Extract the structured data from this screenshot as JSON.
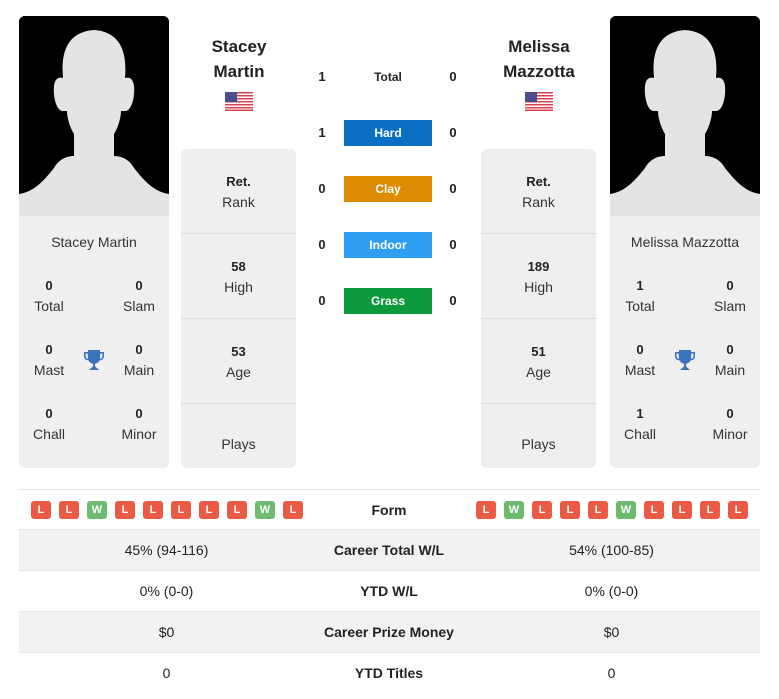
{
  "players": {
    "left": {
      "name_line1": "Stacey",
      "name_line2": "Martin",
      "full_name": "Stacey Martin",
      "country_flag": "us-flag-icon",
      "titles": {
        "total": {
          "value": "0",
          "label": "Total"
        },
        "slam": {
          "value": "0",
          "label": "Slam"
        },
        "mast": {
          "value": "0",
          "label": "Mast"
        },
        "main": {
          "value": "0",
          "label": "Main"
        },
        "chall": {
          "value": "0",
          "label": "Chall"
        },
        "minor": {
          "value": "0",
          "label": "Minor"
        }
      },
      "info": {
        "rank": {
          "value": "Ret.",
          "label": "Rank"
        },
        "high": {
          "value": "58",
          "label": "High"
        },
        "age": {
          "value": "53",
          "label": "Age"
        },
        "plays": {
          "value": "",
          "label": "Plays"
        }
      },
      "form": [
        "L",
        "L",
        "W",
        "L",
        "L",
        "L",
        "L",
        "L",
        "W",
        "L"
      ]
    },
    "right": {
      "name_line1": "Melissa",
      "name_line2": "Mazzotta",
      "full_name": "Melissa Mazzotta",
      "country_flag": "us-flag-icon",
      "titles": {
        "total": {
          "value": "1",
          "label": "Total"
        },
        "slam": {
          "value": "0",
          "label": "Slam"
        },
        "mast": {
          "value": "0",
          "label": "Mast"
        },
        "main": {
          "value": "0",
          "label": "Main"
        },
        "chall": {
          "value": "1",
          "label": "Chall"
        },
        "minor": {
          "value": "0",
          "label": "Minor"
        }
      },
      "info": {
        "rank": {
          "value": "Ret.",
          "label": "Rank"
        },
        "high": {
          "value": "189",
          "label": "High"
        },
        "age": {
          "value": "51",
          "label": "Age"
        },
        "plays": {
          "value": "",
          "label": "Plays"
        }
      },
      "form": [
        "L",
        "W",
        "L",
        "L",
        "L",
        "W",
        "L",
        "L",
        "L",
        "L"
      ]
    }
  },
  "h2h": [
    {
      "label": "Total",
      "left": "1",
      "right": "0",
      "color": ""
    },
    {
      "label": "Hard",
      "left": "1",
      "right": "0",
      "color": "#0a6fc2"
    },
    {
      "label": "Clay",
      "left": "0",
      "right": "0",
      "color": "#df8c05"
    },
    {
      "label": "Indoor",
      "left": "0",
      "right": "0",
      "color": "#2e9ef2"
    },
    {
      "label": "Grass",
      "left": "0",
      "right": "0",
      "color": "#0c9a3c"
    }
  ],
  "form_label": "Form",
  "comparison": [
    {
      "label": "Career Total W/L",
      "left": "45% (94-116)",
      "right": "54% (100-85)"
    },
    {
      "label": "YTD W/L",
      "left": "0% (0-0)",
      "right": "0% (0-0)"
    },
    {
      "label": "Career Prize Money",
      "left": "$0",
      "right": "$0"
    },
    {
      "label": "YTD Titles",
      "left": "0",
      "right": "0"
    }
  ],
  "colors": {
    "loss": "#ea5a45",
    "win": "#6cbb6f",
    "trophy": "#3a72c0"
  }
}
